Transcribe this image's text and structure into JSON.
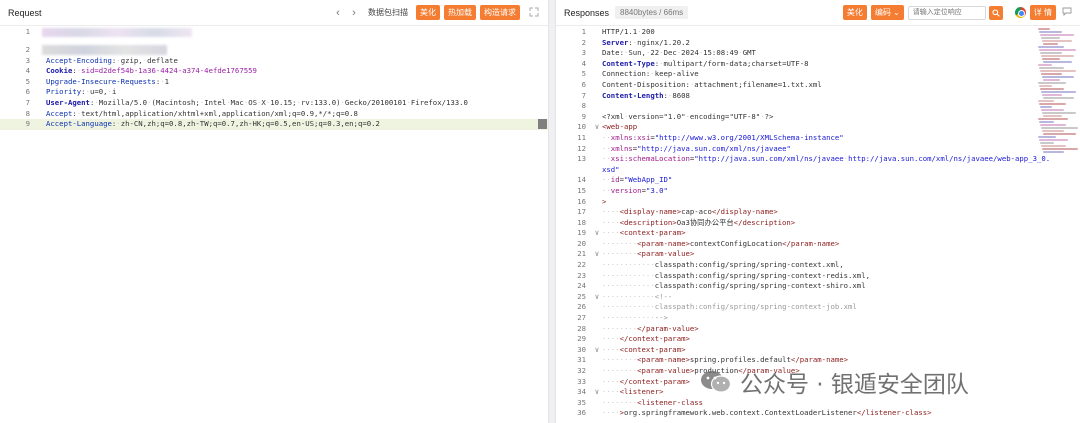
{
  "left": {
    "title": "Request",
    "nav_prev": "‹",
    "nav_next": "›",
    "tool_label": "数据包扫描",
    "buttons": [
      "美化",
      "热加载",
      "构造请求"
    ],
    "lines": [
      {
        "n": "1",
        "parts": []
      },
      {
        "n": "2",
        "parts": []
      },
      {
        "n": "3",
        "parts": [
          {
            "c": "kb",
            "t": "Accept-Encoding"
          },
          {
            "c": "v",
            "t": ":"
          },
          {
            "c": "ws",
            "t": "·"
          },
          {
            "c": "v",
            "t": "gzip,"
          },
          {
            "c": "ws",
            "t": "·"
          },
          {
            "c": "v",
            "t": "deflate"
          }
        ]
      },
      {
        "n": "4",
        "parts": [
          {
            "c": "k",
            "t": "Cookie"
          },
          {
            "c": "v",
            "t": ":"
          },
          {
            "c": "ws",
            "t": "·"
          },
          {
            "c": "purple",
            "t": "sid=d2def54b-1a36-4424-a374-4efde1767559"
          }
        ]
      },
      {
        "n": "5",
        "parts": [
          {
            "c": "kb",
            "t": "Upgrade-Insecure-Requests"
          },
          {
            "c": "v",
            "t": ":"
          },
          {
            "c": "ws",
            "t": "·"
          },
          {
            "c": "v",
            "t": "1"
          }
        ]
      },
      {
        "n": "6",
        "parts": [
          {
            "c": "kb",
            "t": "Priority"
          },
          {
            "c": "v",
            "t": ":"
          },
          {
            "c": "ws",
            "t": "·"
          },
          {
            "c": "v",
            "t": "u=0,"
          },
          {
            "c": "ws",
            "t": "·"
          },
          {
            "c": "v",
            "t": "i"
          }
        ]
      },
      {
        "n": "7",
        "parts": [
          {
            "c": "k",
            "t": "User-Agent"
          },
          {
            "c": "v",
            "t": ":"
          },
          {
            "c": "ws",
            "t": "·"
          },
          {
            "c": "v",
            "t": "Mozilla/5.0"
          },
          {
            "c": "ws",
            "t": "·"
          },
          {
            "c": "v",
            "t": "(Macintosh;"
          },
          {
            "c": "ws",
            "t": "·"
          },
          {
            "c": "v",
            "t": "Intel"
          },
          {
            "c": "ws",
            "t": "·"
          },
          {
            "c": "v",
            "t": "Mac"
          },
          {
            "c": "ws",
            "t": "·"
          },
          {
            "c": "v",
            "t": "OS"
          },
          {
            "c": "ws",
            "t": "·"
          },
          {
            "c": "v",
            "t": "X"
          },
          {
            "c": "ws",
            "t": "·"
          },
          {
            "c": "v",
            "t": "10.15;"
          },
          {
            "c": "ws",
            "t": "·"
          },
          {
            "c": "v",
            "t": "rv:133.0)"
          },
          {
            "c": "ws",
            "t": "·"
          },
          {
            "c": "v",
            "t": "Gecko/20100101"
          },
          {
            "c": "ws",
            "t": "·"
          },
          {
            "c": "v",
            "t": "Firefox/133.0"
          }
        ]
      },
      {
        "n": "8",
        "parts": [
          {
            "c": "kb",
            "t": "Accept"
          },
          {
            "c": "v",
            "t": ":"
          },
          {
            "c": "ws",
            "t": "·"
          },
          {
            "c": "v",
            "t": "text/html,application/xhtml+xml,application/xml;q=0.9,*/*;q=0.8"
          }
        ]
      },
      {
        "n": "9",
        "hl": true,
        "parts": [
          {
            "c": "kb",
            "t": "Accept-Language"
          },
          {
            "c": "v",
            "t": ":"
          },
          {
            "c": "ws",
            "t": "·"
          },
          {
            "c": "v",
            "t": "zh-CN,zh;q=0.8,zh-TW;q=0.7,zh-HK;q=0.5,en-US;q=0.3,en;q=0.2"
          }
        ]
      }
    ]
  },
  "right": {
    "title": "Responses",
    "info": "8840bytes / 66ms",
    "buttons": [
      "美化",
      "编码"
    ],
    "search_placeholder": "请输入定位响应",
    "detail_button": "详 情",
    "lines": [
      {
        "n": "1",
        "parts": [
          {
            "c": "v",
            "t": "HTTP/1.1"
          },
          {
            "c": "ws",
            "t": "·"
          },
          {
            "c": "v",
            "t": "200"
          }
        ]
      },
      {
        "n": "2",
        "parts": [
          {
            "c": "k",
            "t": "Server"
          },
          {
            "c": "v",
            "t": ":"
          },
          {
            "c": "ws",
            "t": "·"
          },
          {
            "c": "v",
            "t": "nginx/1.20.2"
          }
        ]
      },
      {
        "n": "3",
        "parts": [
          {
            "c": "v",
            "t": "Date:"
          },
          {
            "c": "ws",
            "t": "·"
          },
          {
            "c": "v",
            "t": "Sun,"
          },
          {
            "c": "ws",
            "t": "·"
          },
          {
            "c": "v",
            "t": "22"
          },
          {
            "c": "ws",
            "t": "·"
          },
          {
            "c": "v",
            "t": "Dec"
          },
          {
            "c": "ws",
            "t": "·"
          },
          {
            "c": "v",
            "t": "2024"
          },
          {
            "c": "ws",
            "t": "·"
          },
          {
            "c": "v",
            "t": "15:08:49"
          },
          {
            "c": "ws",
            "t": "·"
          },
          {
            "c": "v",
            "t": "GMT"
          }
        ]
      },
      {
        "n": "4",
        "parts": [
          {
            "c": "k",
            "t": "Content-Type"
          },
          {
            "c": "v",
            "t": ":"
          },
          {
            "c": "ws",
            "t": "·"
          },
          {
            "c": "v",
            "t": "multipart/form-data;charset=UTF-8"
          }
        ]
      },
      {
        "n": "5",
        "parts": [
          {
            "c": "v",
            "t": "Connection:"
          },
          {
            "c": "ws",
            "t": "·"
          },
          {
            "c": "v",
            "t": "keep-alive"
          }
        ]
      },
      {
        "n": "6",
        "parts": [
          {
            "c": "v",
            "t": "Content-Disposition:"
          },
          {
            "c": "ws",
            "t": "·"
          },
          {
            "c": "v",
            "t": "attachment;filename=1.txt.xml"
          }
        ]
      },
      {
        "n": "7",
        "parts": [
          {
            "c": "k",
            "t": "Content-Length"
          },
          {
            "c": "v",
            "t": ":"
          },
          {
            "c": "ws",
            "t": "·"
          },
          {
            "c": "v",
            "t": "8608"
          }
        ]
      },
      {
        "n": "8",
        "parts": []
      },
      {
        "n": "9",
        "parts": [
          {
            "c": "v",
            "t": "<?xml"
          },
          {
            "c": "ws",
            "t": "·"
          },
          {
            "c": "v",
            "t": "version=\"1.0\""
          },
          {
            "c": "ws",
            "t": "·"
          },
          {
            "c": "v",
            "t": "encoding=\"UTF-8\""
          },
          {
            "c": "ws",
            "t": "·"
          },
          {
            "c": "v",
            "t": "?>"
          }
        ]
      },
      {
        "n": "10",
        "fold": "∨",
        "parts": [
          {
            "c": "tag",
            "t": "<web-app"
          }
        ]
      },
      {
        "n": "11",
        "parts": [
          {
            "c": "ws",
            "t": "··"
          },
          {
            "c": "attr",
            "t": "xmlns:xsi"
          },
          {
            "c": "v",
            "t": "="
          },
          {
            "c": "str",
            "t": "\"http://www.w3.org/2001/XMLSchema-instance\""
          }
        ]
      },
      {
        "n": "12",
        "parts": [
          {
            "c": "ws",
            "t": "··"
          },
          {
            "c": "attr",
            "t": "xmlns"
          },
          {
            "c": "v",
            "t": "="
          },
          {
            "c": "str",
            "t": "\"http://java.sun.com/xml/ns/javaee\""
          }
        ]
      },
      {
        "n": "13",
        "parts": [
          {
            "c": "ws",
            "t": "··"
          },
          {
            "c": "attr",
            "t": "xsi:schemaLocation"
          },
          {
            "c": "v",
            "t": "="
          },
          {
            "c": "str",
            "t": "\"http://java.sun.com/xml/ns/javaee"
          },
          {
            "c": "ws",
            "t": "·"
          },
          {
            "c": "str",
            "t": "http://java.sun.com/xml/ns/javaee/web-app_3_0."
          }
        ]
      },
      {
        "n": "",
        "parts": [
          {
            "c": "str",
            "t": "xsd\""
          }
        ]
      },
      {
        "n": "14",
        "parts": [
          {
            "c": "ws",
            "t": "··"
          },
          {
            "c": "attr",
            "t": "id"
          },
          {
            "c": "v",
            "t": "="
          },
          {
            "c": "str",
            "t": "\"WebApp_ID\""
          }
        ]
      },
      {
        "n": "15",
        "parts": [
          {
            "c": "ws",
            "t": "··"
          },
          {
            "c": "attr",
            "t": "version"
          },
          {
            "c": "v",
            "t": "="
          },
          {
            "c": "str",
            "t": "\"3.0\""
          }
        ]
      },
      {
        "n": "16",
        "parts": [
          {
            "c": "tag",
            "t": ">"
          }
        ]
      },
      {
        "n": "17",
        "parts": [
          {
            "c": "ws",
            "t": "····"
          },
          {
            "c": "tag",
            "t": "<display-name>"
          },
          {
            "c": "v",
            "t": "cap-aco"
          },
          {
            "c": "tag",
            "t": "</display-name>"
          }
        ]
      },
      {
        "n": "18",
        "parts": [
          {
            "c": "ws",
            "t": "····"
          },
          {
            "c": "tag",
            "t": "<description>"
          },
          {
            "c": "v",
            "t": "Oa3协同办公平台"
          },
          {
            "c": "tag",
            "t": "</description>"
          }
        ]
      },
      {
        "n": "19",
        "fold": "∨",
        "parts": [
          {
            "c": "ws",
            "t": "····"
          },
          {
            "c": "tag",
            "t": "<context-param>"
          }
        ]
      },
      {
        "n": "20",
        "parts": [
          {
            "c": "ws",
            "t": "········"
          },
          {
            "c": "tag",
            "t": "<param-name>"
          },
          {
            "c": "v",
            "t": "contextConfigLocation"
          },
          {
            "c": "tag",
            "t": "</param-name>"
          }
        ]
      },
      {
        "n": "21",
        "fold": "∨",
        "parts": [
          {
            "c": "ws",
            "t": "········"
          },
          {
            "c": "tag",
            "t": "<param-value>"
          }
        ]
      },
      {
        "n": "22",
        "parts": [
          {
            "c": "ws",
            "t": "············"
          },
          {
            "c": "v",
            "t": "classpath:config/spring/spring-context.xml,"
          }
        ]
      },
      {
        "n": "23",
        "parts": [
          {
            "c": "ws",
            "t": "············"
          },
          {
            "c": "v",
            "t": "classpath:config/spring/spring-context-redis.xml,"
          }
        ]
      },
      {
        "n": "24",
        "parts": [
          {
            "c": "ws",
            "t": "············"
          },
          {
            "c": "v",
            "t": "classpath:config/spring/spring-context-shiro.xml"
          }
        ]
      },
      {
        "n": "25",
        "fold": "∨",
        "parts": [
          {
            "c": "ws",
            "t": "············"
          },
          {
            "c": "cmt",
            "t": "<!--"
          }
        ]
      },
      {
        "n": "26",
        "parts": [
          {
            "c": "ws",
            "t": "············"
          },
          {
            "c": "cmt",
            "t": "classpath:config/spring/spring-context-job.xml"
          }
        ]
      },
      {
        "n": "27",
        "parts": [
          {
            "c": "ws",
            "t": "············"
          },
          {
            "c": "cmt",
            "t": "-->"
          }
        ]
      },
      {
        "n": "28",
        "parts": [
          {
            "c": "ws",
            "t": "········"
          },
          {
            "c": "tag",
            "t": "</param-value>"
          }
        ]
      },
      {
        "n": "29",
        "parts": [
          {
            "c": "ws",
            "t": "····"
          },
          {
            "c": "tag",
            "t": "</context-param>"
          }
        ]
      },
      {
        "n": "30",
        "fold": "∨",
        "parts": [
          {
            "c": "ws",
            "t": "····"
          },
          {
            "c": "tag",
            "t": "<context-param>"
          }
        ]
      },
      {
        "n": "31",
        "parts": [
          {
            "c": "ws",
            "t": "········"
          },
          {
            "c": "tag",
            "t": "<param-name>"
          },
          {
            "c": "v",
            "t": "spring.profiles.default"
          },
          {
            "c": "tag",
            "t": "</param-name>"
          }
        ]
      },
      {
        "n": "32",
        "parts": [
          {
            "c": "ws",
            "t": "········"
          },
          {
            "c": "tag",
            "t": "<param-value>"
          },
          {
            "c": "v",
            "t": "production"
          },
          {
            "c": "tag",
            "t": "</param-value>"
          }
        ]
      },
      {
        "n": "33",
        "parts": [
          {
            "c": "ws",
            "t": "····"
          },
          {
            "c": "tag",
            "t": "</context-param>"
          }
        ]
      },
      {
        "n": "34",
        "fold": "∨",
        "parts": [
          {
            "c": "ws",
            "t": "····"
          },
          {
            "c": "tag",
            "t": "<listener>"
          }
        ]
      },
      {
        "n": "35",
        "parts": [
          {
            "c": "ws",
            "t": "········"
          },
          {
            "c": "tag",
            "t": "<listener-class"
          }
        ]
      },
      {
        "n": "36",
        "parts": [
          {
            "c": "ws",
            "t": "····"
          },
          {
            "c": "tag",
            "t": ">"
          },
          {
            "c": "v",
            "t": "org.springframework.web.context.ContextLoaderListener"
          },
          {
            "c": "tag",
            "t": "</listener-class>"
          }
        ]
      }
    ]
  },
  "watermark": {
    "text": "公众号 · 银遁安全团队"
  },
  "colors": {
    "accent_orange": "#f47d31",
    "highlight_line": "#eff4e1",
    "header_key": "#1a19a8",
    "xml_tag": "#8b1a1a",
    "xml_attr": "#a01a8a",
    "xml_string": "#1818d8"
  },
  "icons": {
    "prev": "chevron-left-icon",
    "next": "chevron-right-icon",
    "expand": "expand-icon",
    "search": "search-icon",
    "browser": "chrome-icon",
    "chat": "chat-icon",
    "dropdown": "chevron-down-icon",
    "watermark": "wechat-icon"
  }
}
